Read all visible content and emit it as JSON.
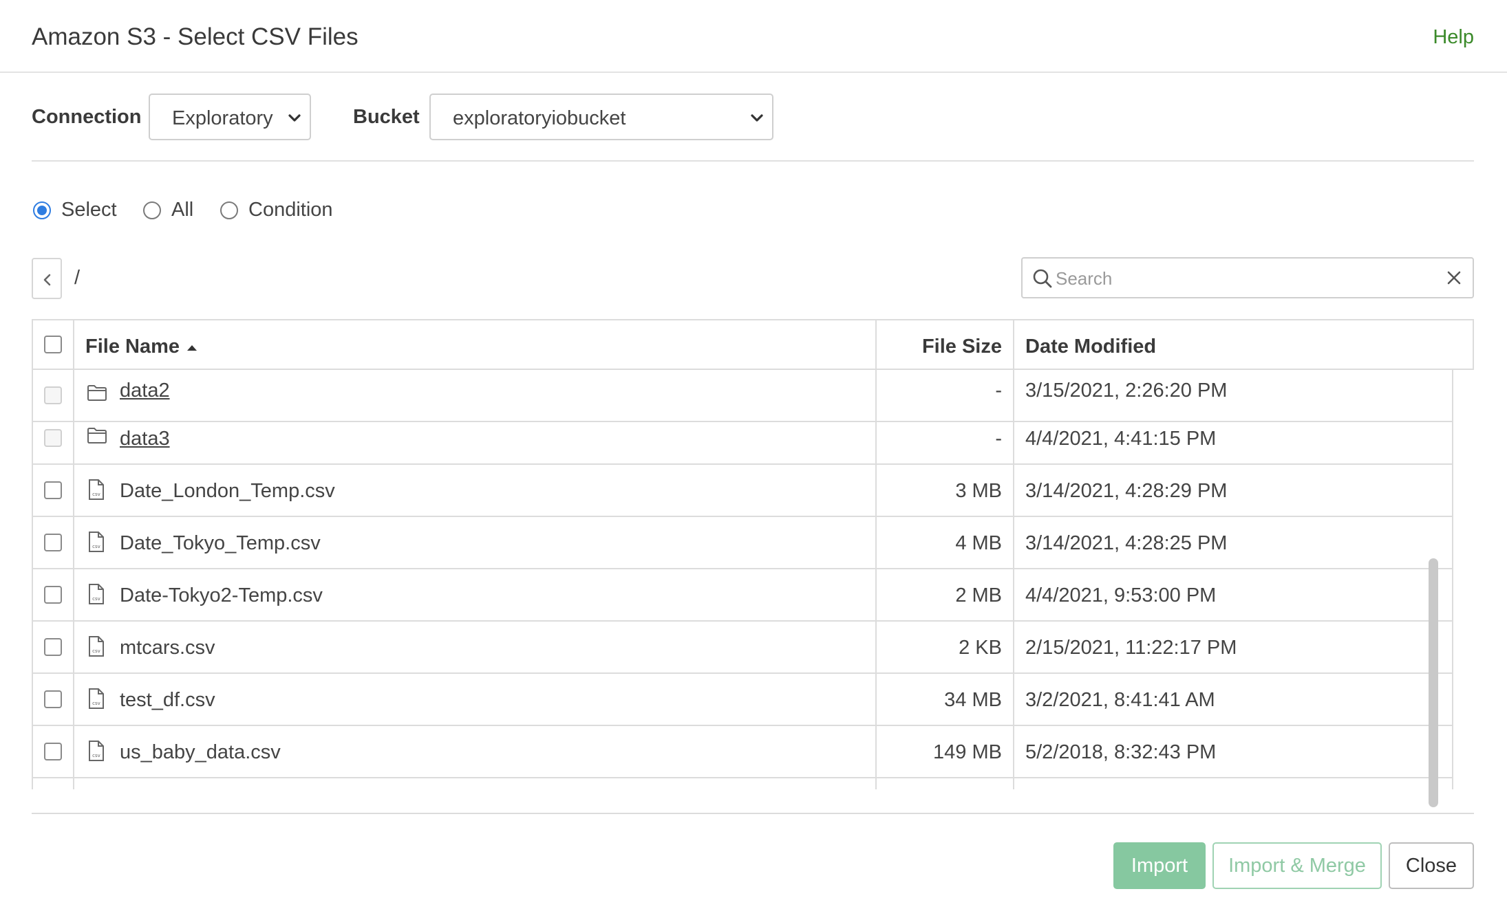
{
  "header": {
    "title": "Amazon S3 - Select CSV Files",
    "help": "Help"
  },
  "connection": {
    "label": "Connection",
    "value": "Exploratory"
  },
  "bucket": {
    "label": "Bucket",
    "value": "exploratoryiobucket"
  },
  "mode": {
    "options": [
      {
        "label": "Select",
        "checked": true
      },
      {
        "label": "All",
        "checked": false
      },
      {
        "label": "Condition",
        "checked": false
      }
    ]
  },
  "path": {
    "current": "/"
  },
  "search": {
    "placeholder": "Search",
    "value": ""
  },
  "table": {
    "columns": {
      "name": "File Name",
      "size": "File Size",
      "date": "Date Modified"
    },
    "sort": {
      "column": "name",
      "direction": "ascending"
    },
    "rows": [
      {
        "type": "folder",
        "name": "data2",
        "size": "-",
        "date": "3/15/2021, 2:26:20 PM"
      },
      {
        "type": "folder",
        "name": "data3",
        "size": "-",
        "date": "4/4/2021, 4:41:15 PM"
      },
      {
        "type": "file",
        "name": "Date_London_Temp.csv",
        "size": "3 MB",
        "date": "3/14/2021, 4:28:29 PM"
      },
      {
        "type": "file",
        "name": "Date_Tokyo_Temp.csv",
        "size": "4 MB",
        "date": "3/14/2021, 4:28:25 PM"
      },
      {
        "type": "file",
        "name": "Date-Tokyo2-Temp.csv",
        "size": "2 MB",
        "date": "4/4/2021, 9:53:00 PM"
      },
      {
        "type": "file",
        "name": "mtcars.csv",
        "size": "2 KB",
        "date": "2/15/2021, 11:22:17 PM"
      },
      {
        "type": "file",
        "name": "test_df.csv",
        "size": "34 MB",
        "date": "3/2/2021, 8:41:41 AM"
      },
      {
        "type": "file",
        "name": "us_baby_data.csv",
        "size": "149 MB",
        "date": "5/2/2018, 8:32:43 PM"
      }
    ]
  },
  "icons": {
    "folder": "folder-icon",
    "file": "csv-file-icon",
    "search": "search-icon",
    "clear": "close-icon",
    "back": "chevron-left-icon",
    "dropdown": "chevron-down-icon",
    "sort": "sort-ascending-icon"
  },
  "footer": {
    "import": "Import",
    "import_merge": "Import & Merge",
    "close": "Close"
  },
  "colors": {
    "accent": "#2f7de1",
    "help": "#3b8a2a",
    "import": "#86c8a0"
  }
}
